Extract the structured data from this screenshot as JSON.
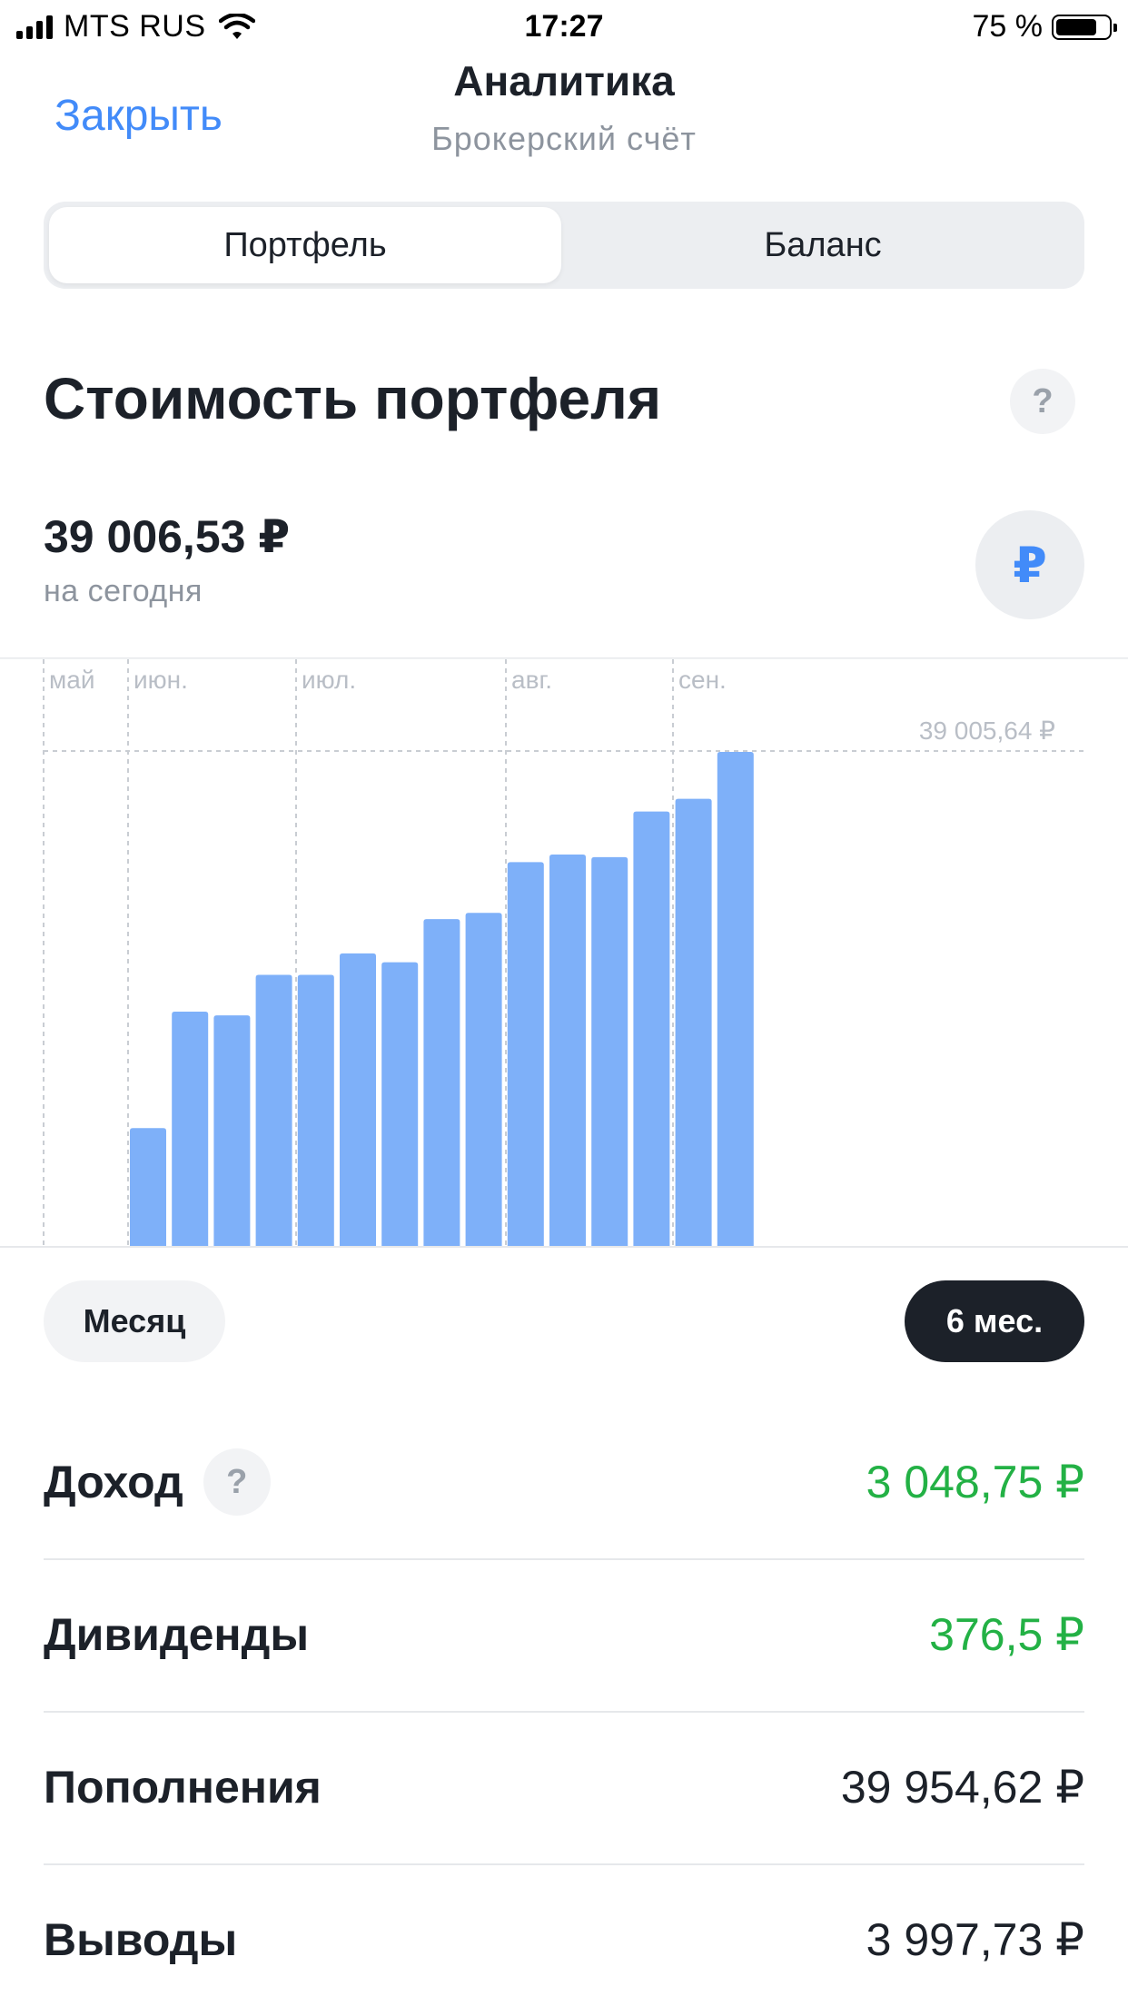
{
  "status_bar": {
    "carrier": "MTS RUS",
    "time": "17:27",
    "battery": "75 %"
  },
  "nav": {
    "close_label": "Закрыть",
    "title": "Аналитика",
    "subtitle": "Брокерский счёт"
  },
  "tabs": [
    {
      "label": "Портфель",
      "active": true
    },
    {
      "label": "Баланс",
      "active": false
    }
  ],
  "section": {
    "title": "Стоимость портфеля",
    "help_symbol": "?"
  },
  "portfolio": {
    "value": "39 006,53 ₽",
    "caption": "на сегодня",
    "currency_symbol": "₽"
  },
  "chart_data": {
    "type": "bar",
    "month_labels": [
      "май",
      "июн.",
      "июл.",
      "авг.",
      "сен."
    ],
    "reference_label": "39 005,64 ₽",
    "reference_value": 39005.64,
    "values": [
      9300,
      18500,
      18200,
      21400,
      21400,
      23100,
      22400,
      25800,
      26300,
      30300,
      30900,
      30700,
      34300,
      35300,
      39005.64
    ],
    "ylim": [
      0,
      39005.64
    ],
    "bar_color": "#7eb0f9"
  },
  "periods": {
    "month_label": "Месяц",
    "six_months_label": "6 мес."
  },
  "stats": [
    {
      "label": "Доход",
      "value": "3 048,75 ₽",
      "help": "?"
    },
    {
      "label": "Дивиденды",
      "value": "376,5 ₽"
    },
    {
      "label": "Пополнения",
      "value": "39 954,62 ₽"
    },
    {
      "label": "Выводы",
      "value": "3 997,73 ₽"
    }
  ],
  "colors": {
    "accent": "#428bf9",
    "positive": "#23b145",
    "dark_chip": "#1c2129"
  }
}
